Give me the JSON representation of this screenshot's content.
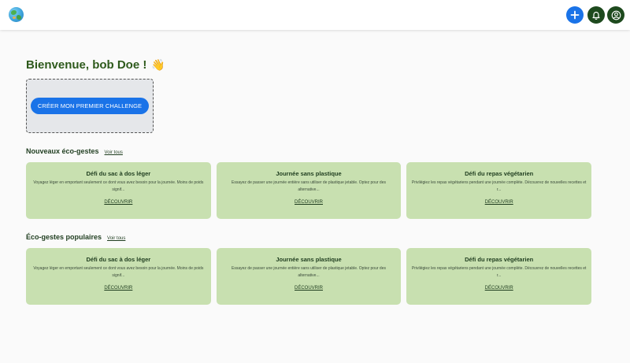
{
  "header": {
    "logo_icon": "globe-icon",
    "buttons": [
      {
        "icon": "plus-icon",
        "color": "#1a73e8"
      },
      {
        "icon": "bell-icon",
        "color": "#1e4a1e"
      },
      {
        "icon": "user-circle-icon",
        "color": "#1e4a1e"
      }
    ]
  },
  "welcome": {
    "text": "Bienvenue, bob Doe !",
    "emoji": "👋"
  },
  "challenge": {
    "button_label": "CRÉER MON PREMIER CHALLENGE"
  },
  "sections": [
    {
      "title": "Nouveaux éco-gestes",
      "link": "Voir tous",
      "cards": [
        {
          "title": "Défi du sac à dos léger",
          "description": "Voyagez léger en emportant seulement ce dont vous avez besoin pour la journée. Moins de poids signif...",
          "link": "DÉCOUVRIR"
        },
        {
          "title": "Journée sans plastique",
          "description": "Essayez de passer une journée entière sans utiliser de plastique jetable. Optez pour des alternative...",
          "link": "DÉCOUVRIR"
        },
        {
          "title": "Défi du repas végétarien",
          "description": "Privilégiez les repas végétariens pendant une journée complète. Découvrez de nouvelles recettes et r...",
          "link": "DÉCOUVRIR"
        }
      ]
    },
    {
      "title": "Éco-gestes populaires",
      "link": "Voir tous",
      "cards": [
        {
          "title": "Défi du sac à dos léger",
          "description": "Voyagez léger en emportant seulement ce dont vous avez besoin pour la journée. Moins de poids signif...",
          "link": "DÉCOUVRIR"
        },
        {
          "title": "Journée sans plastique",
          "description": "Essayez de passer une journée entière sans utiliser de plastique jetable. Optez pour des alternative...",
          "link": "DÉCOUVRIR"
        },
        {
          "title": "Défi du repas végétarien",
          "description": "Privilégiez les repas végétariens pendant une journée complète. Découvrez de nouvelles recettes et r...",
          "link": "DÉCOUVRIR"
        }
      ]
    }
  ],
  "colors": {
    "card_bg": "#c8e0b0",
    "primary_blue": "#1a73e8",
    "dark_green": "#1e4a1e"
  }
}
